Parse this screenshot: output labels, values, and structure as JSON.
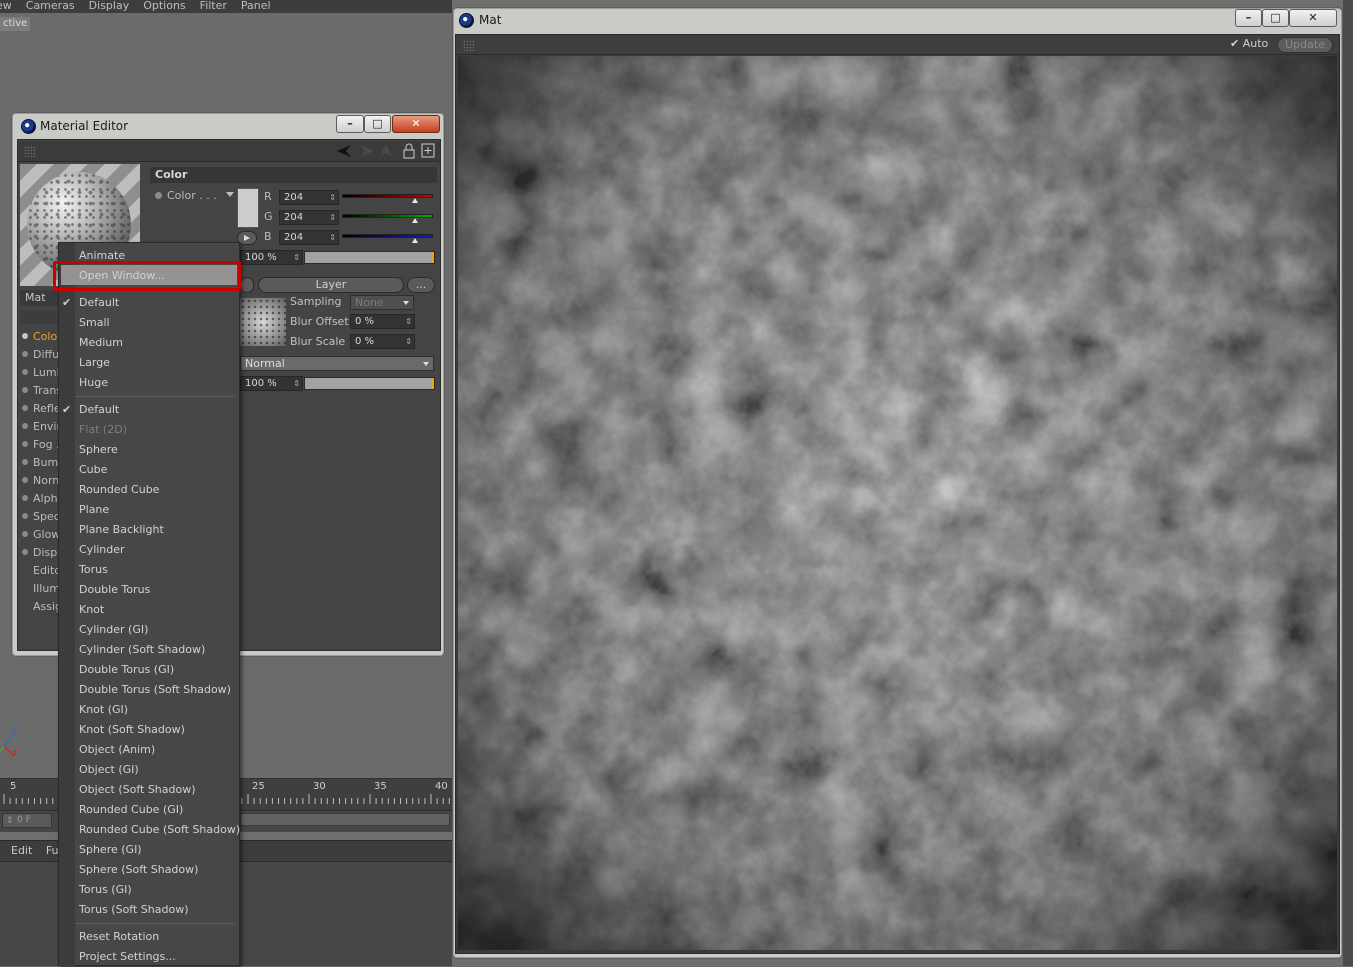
{
  "background_app": {
    "menubar": [
      "ew",
      "Cameras",
      "Display",
      "Options",
      "Filter",
      "Panel"
    ],
    "viewport_tag": "ctive",
    "timeline_numbers": [
      "5",
      "25",
      "30",
      "35",
      "40"
    ],
    "frame_field": "0 F",
    "bottom_menu": [
      "Edit",
      "Fu"
    ]
  },
  "material_editor": {
    "title": "Material Editor",
    "material_name": "Mat",
    "channels": [
      {
        "label": "Colo",
        "active": true,
        "dot": true
      },
      {
        "label": "Diffu",
        "active": false,
        "dot": true
      },
      {
        "label": "Lumi",
        "active": false,
        "dot": true
      },
      {
        "label": "Trans",
        "active": false,
        "dot": true
      },
      {
        "label": "Refle",
        "active": false,
        "dot": true
      },
      {
        "label": "Envir",
        "active": false,
        "dot": true
      },
      {
        "label": "Fog .",
        "active": false,
        "dot": true
      },
      {
        "label": "Bump",
        "active": false,
        "dot": true
      },
      {
        "label": "Norn",
        "active": false,
        "dot": true
      },
      {
        "label": "Alph",
        "active": false,
        "dot": true
      },
      {
        "label": "Spec",
        "active": false,
        "dot": true
      },
      {
        "label": "Glow",
        "active": false,
        "dot": true
      },
      {
        "label": "Displ",
        "active": false,
        "dot": true
      },
      {
        "label": "Editc",
        "active": false,
        "dot": false
      },
      {
        "label": "Illum",
        "active": false,
        "dot": false
      },
      {
        "label": "Assig",
        "active": false,
        "dot": false
      }
    ],
    "section_title": "Color",
    "color_label": "Color . . .",
    "swatch_color": "#cccccc",
    "rgb": [
      {
        "channel": "R",
        "value": "204",
        "slider_color": "#cc0000",
        "fraction": 0.8
      },
      {
        "channel": "G",
        "value": "204",
        "slider_color": "#00b000",
        "fraction": 0.8
      },
      {
        "channel": "B",
        "value": "204",
        "slider_color": "#1a1acc",
        "fraction": 0.8
      }
    ],
    "brightness": "100 %",
    "layer_button": "Layer",
    "more_button": "...",
    "sampling_label": "Sampling",
    "sampling_value": "None",
    "blur_offset_label": "Blur Offset",
    "blur_offset_value": "0 %",
    "blur_scale_label": "Blur Scale",
    "blur_scale_value": "0 %",
    "blend_mode": "Normal",
    "mix_strength": "100 %"
  },
  "context_menu": {
    "items": [
      {
        "label": "Animate",
        "checked": false,
        "disabled": false
      },
      {
        "label": "Open Window...",
        "checked": false,
        "disabled": false,
        "highlighted": true
      },
      {
        "sep": true
      },
      {
        "label": "Default",
        "checked": true,
        "disabled": false
      },
      {
        "label": "Small",
        "checked": false,
        "disabled": false
      },
      {
        "label": "Medium",
        "checked": false,
        "disabled": false
      },
      {
        "label": "Large",
        "checked": false,
        "disabled": false
      },
      {
        "label": "Huge",
        "checked": false,
        "disabled": false
      },
      {
        "sep": true
      },
      {
        "label": "Default",
        "checked": true,
        "disabled": false
      },
      {
        "label": "Flat (2D)",
        "checked": false,
        "disabled": true
      },
      {
        "label": "Sphere",
        "checked": false,
        "disabled": false
      },
      {
        "label": "Cube",
        "checked": false,
        "disabled": false
      },
      {
        "label": "Rounded Cube",
        "checked": false,
        "disabled": false
      },
      {
        "label": "Plane",
        "checked": false,
        "disabled": false
      },
      {
        "label": "Plane Backlight",
        "checked": false,
        "disabled": false
      },
      {
        "label": "Cylinder",
        "checked": false,
        "disabled": false
      },
      {
        "label": "Torus",
        "checked": false,
        "disabled": false
      },
      {
        "label": "Double Torus",
        "checked": false,
        "disabled": false
      },
      {
        "label": "Knot",
        "checked": false,
        "disabled": false
      },
      {
        "label": "Cylinder (GI)",
        "checked": false,
        "disabled": false
      },
      {
        "label": "Cylinder (Soft Shadow)",
        "checked": false,
        "disabled": false
      },
      {
        "label": "Double Torus (GI)",
        "checked": false,
        "disabled": false
      },
      {
        "label": "Double Torus (Soft Shadow)",
        "checked": false,
        "disabled": false
      },
      {
        "label": "Knot (GI)",
        "checked": false,
        "disabled": false
      },
      {
        "label": "Knot (Soft Shadow)",
        "checked": false,
        "disabled": false
      },
      {
        "label": "Object (Anim)",
        "checked": false,
        "disabled": false
      },
      {
        "label": "Object (GI)",
        "checked": false,
        "disabled": false
      },
      {
        "label": "Object (Soft Shadow)",
        "checked": false,
        "disabled": false
      },
      {
        "label": "Rounded Cube (GI)",
        "checked": false,
        "disabled": false
      },
      {
        "label": "Rounded Cube (Soft Shadow)",
        "checked": false,
        "disabled": false
      },
      {
        "label": "Sphere (GI)",
        "checked": false,
        "disabled": false
      },
      {
        "label": "Sphere (Soft Shadow)",
        "checked": false,
        "disabled": false
      },
      {
        "label": "Torus (GI)",
        "checked": false,
        "disabled": false
      },
      {
        "label": "Torus (Soft Shadow)",
        "checked": false,
        "disabled": false
      },
      {
        "sep": true
      },
      {
        "label": "Reset Rotation",
        "checked": false,
        "disabled": false
      },
      {
        "label": "Project Settings...",
        "checked": false,
        "disabled": false
      }
    ]
  },
  "mat_window": {
    "title": "Mat",
    "auto_label": "Auto",
    "auto_checked": true,
    "update_label": "Update"
  },
  "window_buttons": {
    "minimize": "–",
    "maximize": "□",
    "close": "✕"
  },
  "colors": {
    "accent": "#f0a020",
    "highlight_border": "#cc0000"
  }
}
